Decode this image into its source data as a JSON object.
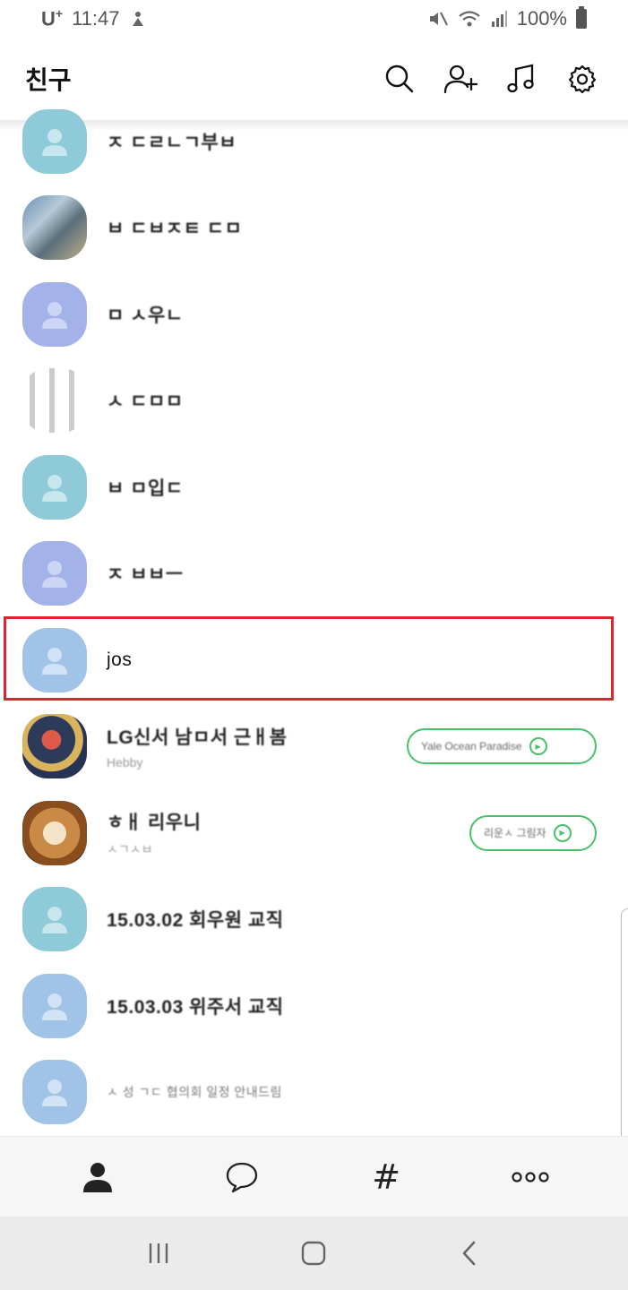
{
  "status": {
    "carrier": "U",
    "carrier_sup": "+",
    "time": "11:47",
    "battery": "100%"
  },
  "header": {
    "title": "친구"
  },
  "friends": [
    {
      "name": "ㅈ ㄷㄹㄴㄱ부ㅂ",
      "sub": ""
    },
    {
      "name": "ㅂ ㄷㅂㅈㅌ ㄷㅁ",
      "sub": ""
    },
    {
      "name": "ㅁ ㅅ우ㄴ",
      "sub": ""
    },
    {
      "name": "ㅅ ㄷㅁㅁ",
      "sub": ""
    },
    {
      "name": "ㅂ ㅁ입ㄷ",
      "sub": ""
    },
    {
      "name": "ㅈ ㅂㅂㅡ",
      "sub": ""
    },
    {
      "name": "jos",
      "sub": ""
    },
    {
      "name": "LG신서 남ㅁ서 근ㅐ봄",
      "sub": "Hebby",
      "music": "Yale Ocean Paradise"
    },
    {
      "name": "ㅎㅐ 리우니",
      "sub": "ㅅㄱㅅㅂ",
      "music": "리운ㅅ 그림자"
    },
    {
      "name": "15.03.02 회우원 교직",
      "sub": ""
    },
    {
      "name": "15.03.03 위주서 교직",
      "sub": ""
    },
    {
      "name": "ㅅ 성 ㄱㄷ 협의회 일정 안내드림",
      "sub": ""
    }
  ],
  "highlight_index": 6,
  "nav": {
    "friends": "friends-icon",
    "chats": "chat-icon",
    "hashtag": "#",
    "more": "more-icon"
  }
}
